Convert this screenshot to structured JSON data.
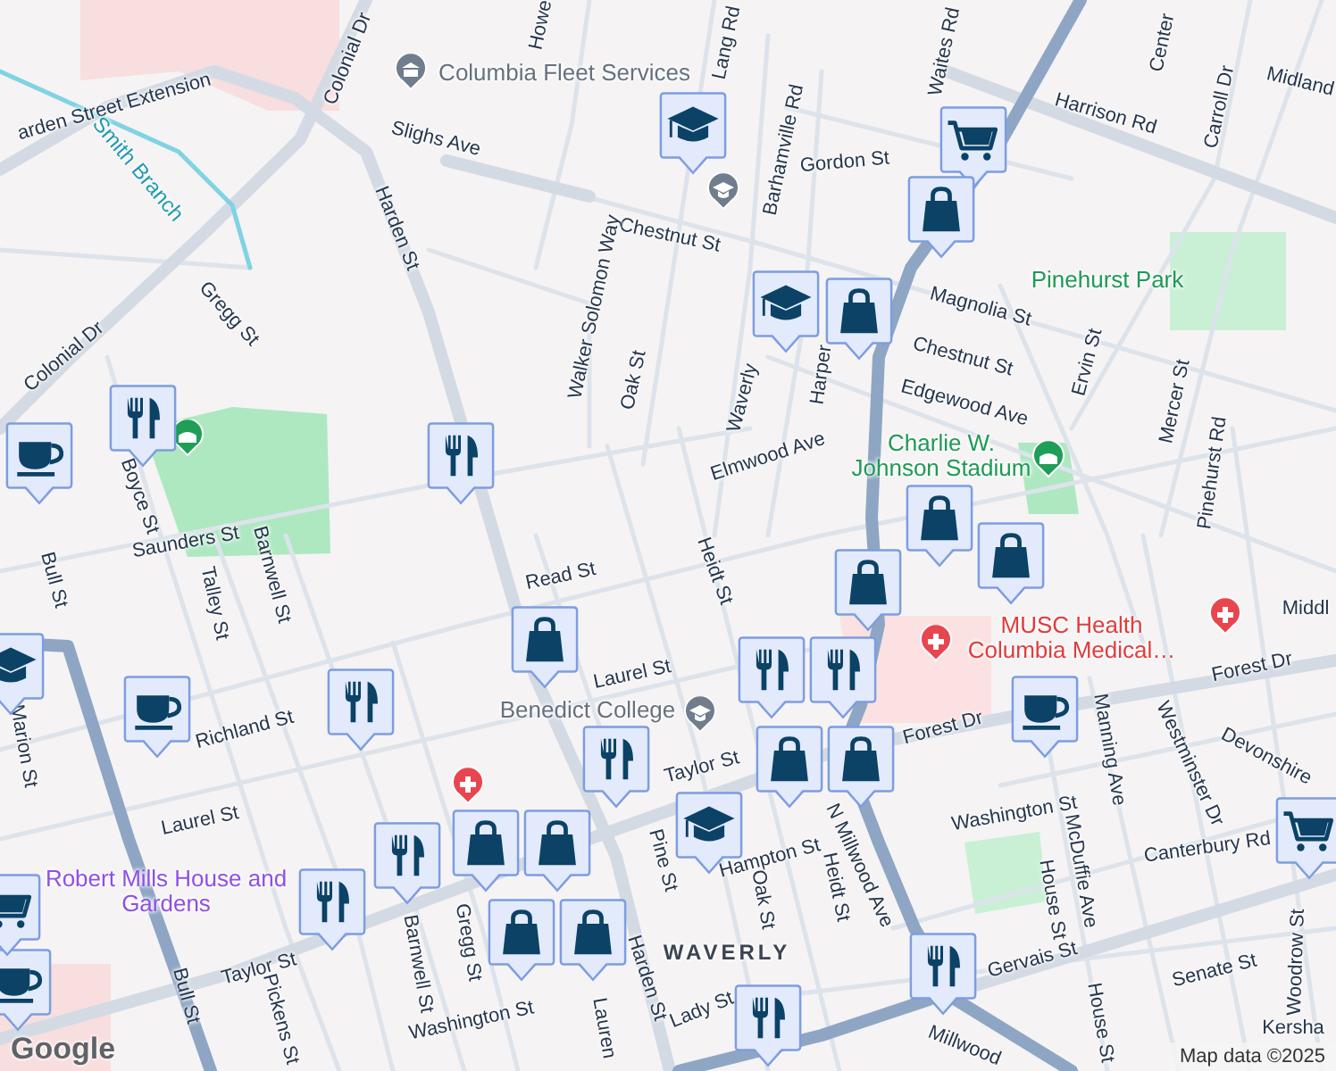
{
  "map": {
    "streets": [
      {
        "name": "arden Street Extension"
      },
      {
        "name": "Colonial Dr"
      },
      {
        "name": "Slighs Ave"
      },
      {
        "name": "Howe"
      },
      {
        "name": "Lang Rd"
      },
      {
        "name": "Waites Rd"
      },
      {
        "name": "Barhamville Rd"
      },
      {
        "name": "Gordon St"
      },
      {
        "name": "Chestnut St"
      },
      {
        "name": "Harrison Rd"
      },
      {
        "name": "Center"
      },
      {
        "name": "Carroll Dr"
      },
      {
        "name": "Midland"
      },
      {
        "name": "Harden St"
      },
      {
        "name": "Gregg St"
      },
      {
        "name": "Colonial Dr"
      },
      {
        "name": "Walker Solomon Way"
      },
      {
        "name": "Oak St"
      },
      {
        "name": "Magnolia St"
      },
      {
        "name": "Chestnut St"
      },
      {
        "name": "Edgewood Ave"
      },
      {
        "name": "Waverly"
      },
      {
        "name": "Harper"
      },
      {
        "name": "Elmwood Ave"
      },
      {
        "name": "Ervin St"
      },
      {
        "name": "Mercer St"
      },
      {
        "name": "Pinehurst Rd"
      },
      {
        "name": "Boyce St"
      },
      {
        "name": "Saunders St"
      },
      {
        "name": "Talley St"
      },
      {
        "name": "Barnwell St"
      },
      {
        "name": "Bull St"
      },
      {
        "name": "Read St"
      },
      {
        "name": "Heidt St"
      },
      {
        "name": "Laurel St"
      },
      {
        "name": "Richland St"
      },
      {
        "name": "Marion St"
      },
      {
        "name": "Laurel St"
      },
      {
        "name": "Taylor St"
      },
      {
        "name": "Pickens St"
      },
      {
        "name": "Bull St"
      },
      {
        "name": "Barnwell St"
      },
      {
        "name": "Gregg St"
      },
      {
        "name": "Washington St"
      },
      {
        "name": "Harden St"
      },
      {
        "name": "Pine St"
      },
      {
        "name": "Hampton St"
      },
      {
        "name": "Oak St"
      },
      {
        "name": "Heidt St"
      },
      {
        "name": "N Millwood Ave"
      },
      {
        "name": "Forest Dr"
      },
      {
        "name": "Forest Dr"
      },
      {
        "name": "Washington St"
      },
      {
        "name": "House St"
      },
      {
        "name": "McDuffie Ave"
      },
      {
        "name": "Manning Ave"
      },
      {
        "name": "Westminster Dr"
      },
      {
        "name": "Devonshire"
      },
      {
        "name": "Canterbury Rd"
      },
      {
        "name": "Woodrow St"
      },
      {
        "name": "Senate St"
      },
      {
        "name": "Gervais St"
      },
      {
        "name": "Millwood"
      },
      {
        "name": "House St"
      },
      {
        "name": "Middl"
      },
      {
        "name": "Kersha"
      },
      {
        "name": "Lady St"
      },
      {
        "name": "Taylor St"
      },
      {
        "name": "Lauren"
      }
    ],
    "places": [
      {
        "name": "Columbia Fleet Services",
        "kind": "landmark"
      },
      {
        "name": "Smith Branch",
        "kind": "water"
      },
      {
        "name": "Pinehurst Park",
        "kind": "park"
      },
      {
        "name": "Charlie W. Johnson Stadium",
        "kind": "park"
      },
      {
        "name": "Benedict College",
        "kind": "landmark"
      },
      {
        "name": "MUSC Health Columbia Medical…",
        "kind": "hospital"
      },
      {
        "name": "Robert Mills House and Gardens",
        "kind": "historic"
      }
    ],
    "neighborhood": "WAVERLY",
    "poi_icons": [
      {
        "kind": "landmark"
      },
      {
        "kind": "school"
      },
      {
        "kind": "school"
      },
      {
        "kind": "park"
      },
      {
        "kind": "park"
      },
      {
        "kind": "hospital"
      },
      {
        "kind": "hospital"
      },
      {
        "kind": "hospital"
      }
    ],
    "markers": [
      {
        "kind": "cafe"
      },
      {
        "kind": "restaurant"
      },
      {
        "kind": "restaurant"
      },
      {
        "kind": "school"
      },
      {
        "kind": "grocery"
      },
      {
        "kind": "shopping"
      },
      {
        "kind": "school"
      },
      {
        "kind": "shopping"
      },
      {
        "kind": "shopping"
      },
      {
        "kind": "shopping"
      },
      {
        "kind": "shopping"
      },
      {
        "kind": "cafe"
      },
      {
        "kind": "restaurant"
      },
      {
        "kind": "restaurant"
      },
      {
        "kind": "shopping"
      },
      {
        "kind": "shopping"
      },
      {
        "kind": "school"
      },
      {
        "kind": "cafe"
      },
      {
        "kind": "restaurant"
      },
      {
        "kind": "shopping"
      },
      {
        "kind": "restaurant"
      },
      {
        "kind": "restaurant"
      },
      {
        "kind": "restaurant"
      },
      {
        "kind": "shopping"
      },
      {
        "kind": "shopping"
      },
      {
        "kind": "shopping"
      },
      {
        "kind": "shopping"
      },
      {
        "kind": "restaurant"
      },
      {
        "kind": "restaurant"
      },
      {
        "kind": "grocery"
      },
      {
        "kind": "school"
      },
      {
        "kind": "cafe"
      },
      {
        "kind": "grocery"
      }
    ],
    "attribution": "Map data ©2025",
    "logo": "Google"
  }
}
